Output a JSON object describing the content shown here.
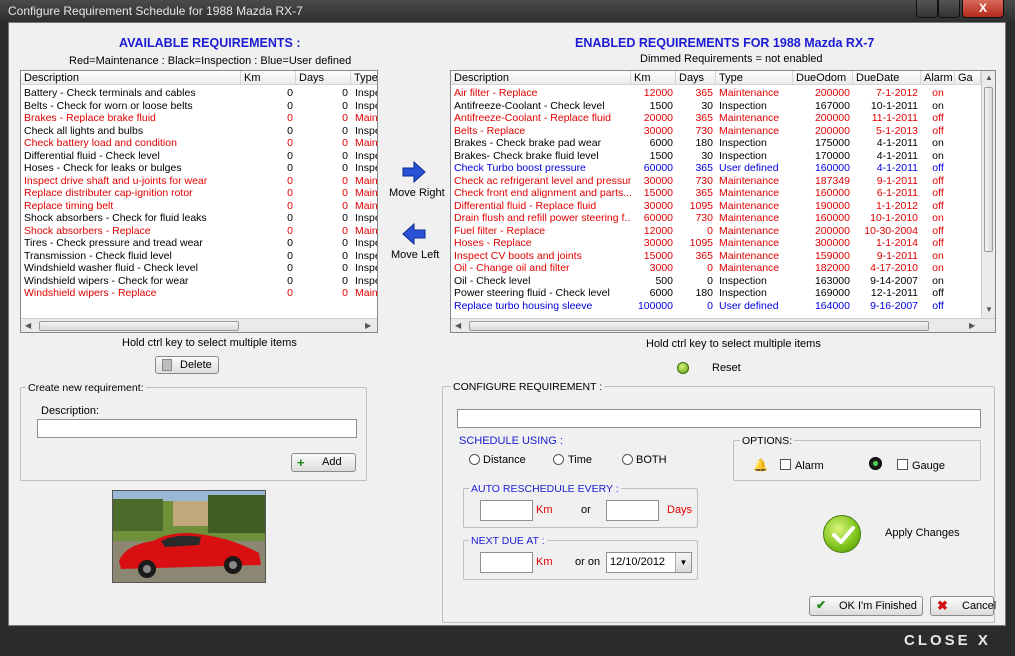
{
  "window": {
    "title": "Configure Requirement Schedule for 1988 Mazda RX-7",
    "close_symbol": "X"
  },
  "available": {
    "heading": "AVAILABLE REQUIREMENTS :",
    "legend": "Red=Maintenance  :  Black=Inspection  :  Blue=User defined",
    "columns": [
      "Description",
      "Km",
      "Days",
      "Type"
    ],
    "rows": [
      {
        "desc": "Battery - Check terminals and cables",
        "km": "0",
        "days": "0",
        "type": "Inspection",
        "color": "blk"
      },
      {
        "desc": "Belts - Check for worn or loose belts",
        "km": "0",
        "days": "0",
        "type": "Inspection",
        "color": "blk"
      },
      {
        "desc": "Brakes - Replace brake fluid",
        "km": "0",
        "days": "0",
        "type": "Maintenance",
        "color": "red"
      },
      {
        "desc": "Check all lights and bulbs",
        "km": "0",
        "days": "0",
        "type": "Inspection",
        "color": "blk"
      },
      {
        "desc": "Check battery load and condition",
        "km": "0",
        "days": "0",
        "type": "Maintenance",
        "color": "red"
      },
      {
        "desc": "Differential fluid - Check level",
        "km": "0",
        "days": "0",
        "type": "Inspection",
        "color": "blk"
      },
      {
        "desc": "Hoses - Check for leaks or bulges",
        "km": "0",
        "days": "0",
        "type": "Inspection",
        "color": "blk"
      },
      {
        "desc": "Inspect drive shaft and u-joints for wear",
        "km": "0",
        "days": "0",
        "type": "Maintenance",
        "color": "red"
      },
      {
        "desc": "Replace distributer cap-ignition rotor",
        "km": "0",
        "days": "0",
        "type": "Maintenance",
        "color": "red"
      },
      {
        "desc": "Replace timing belt",
        "km": "0",
        "days": "0",
        "type": "Maintenance",
        "color": "red"
      },
      {
        "desc": "Shock absorbers - Check for fluid leaks",
        "km": "0",
        "days": "0",
        "type": "Inspection",
        "color": "blk"
      },
      {
        "desc": "Shock absorbers - Replace",
        "km": "0",
        "days": "0",
        "type": "Maintenance",
        "color": "red"
      },
      {
        "desc": "Tires - Check pressure and tread wear",
        "km": "0",
        "days": "0",
        "type": "Inspection",
        "color": "blk"
      },
      {
        "desc": "Transmission - Check fluid level",
        "km": "0",
        "days": "0",
        "type": "Inspection",
        "color": "blk"
      },
      {
        "desc": "Windshield washer fluid - Check level",
        "km": "0",
        "days": "0",
        "type": "Inspection",
        "color": "blk"
      },
      {
        "desc": "Windshield wipers - Check for wear",
        "km": "0",
        "days": "0",
        "type": "Inspection",
        "color": "blk"
      },
      {
        "desc": "Windshield wipers - Replace",
        "km": "0",
        "days": "0",
        "type": "Maintenance",
        "color": "red"
      }
    ],
    "hint": "Hold ctrl key to select multiple items",
    "delete_label": "Delete"
  },
  "move": {
    "right_label": "Move Right",
    "left_label": "Move Left"
  },
  "enabled": {
    "heading": "ENABLED REQUIREMENTS FOR 1988 Mazda RX-7",
    "sub": "Dimmed Requirements = not enabled",
    "columns": [
      "Description",
      "Km",
      "Days",
      "Type",
      "DueOdom",
      "DueDate",
      "Alarm",
      "Ga"
    ],
    "rows": [
      {
        "desc": "Air filter - Replace",
        "km": "12000",
        "days": "365",
        "type": "Maintenance",
        "odom": "200000",
        "date": "7-1-2012",
        "alarm": "on",
        "color": "red"
      },
      {
        "desc": "Antifreeze-Coolant - Check level",
        "km": "1500",
        "days": "30",
        "type": "Inspection",
        "odom": "167000",
        "date": "10-1-2011",
        "alarm": "on",
        "color": "blk"
      },
      {
        "desc": "Antifreeze-Coolant - Replace fluid",
        "km": "20000",
        "days": "365",
        "type": "Maintenance",
        "odom": "200000",
        "date": "11-1-2011",
        "alarm": "off",
        "color": "red"
      },
      {
        "desc": "Belts - Replace",
        "km": "30000",
        "days": "730",
        "type": "Maintenance",
        "odom": "200000",
        "date": "5-1-2013",
        "alarm": "off",
        "color": "red"
      },
      {
        "desc": "Brakes - Check brake pad wear",
        "km": "6000",
        "days": "180",
        "type": "Inspection",
        "odom": "175000",
        "date": "4-1-2011",
        "alarm": "on",
        "color": "blk"
      },
      {
        "desc": "Brakes- Check brake fluid level",
        "km": "1500",
        "days": "30",
        "type": "Inspection",
        "odom": "170000",
        "date": "4-1-2011",
        "alarm": "on",
        "color": "blk"
      },
      {
        "desc": "Check Turbo boost pressure",
        "km": "60000",
        "days": "365",
        "type": "User defined",
        "odom": "160000",
        "date": "4-1-2011",
        "alarm": "off",
        "color": "blue"
      },
      {
        "desc": "Check ac refrigerant level and pressure",
        "km": "30000",
        "days": "730",
        "type": "Maintenance",
        "odom": "187349",
        "date": "9-1-2011",
        "alarm": "off",
        "color": "red"
      },
      {
        "desc": "Check front end alignment and parts...",
        "km": "15000",
        "days": "365",
        "type": "Maintenance",
        "odom": "160000",
        "date": "6-1-2011",
        "alarm": "off",
        "color": "red"
      },
      {
        "desc": "Differential fluid - Replace fluid",
        "km": "30000",
        "days": "1095",
        "type": "Maintenance",
        "odom": "190000",
        "date": "1-1-2012",
        "alarm": "off",
        "color": "red"
      },
      {
        "desc": "Drain flush and refill power steering f...",
        "km": "60000",
        "days": "730",
        "type": "Maintenance",
        "odom": "160000",
        "date": "10-1-2010",
        "alarm": "on",
        "color": "red"
      },
      {
        "desc": "Fuel filter - Replace",
        "km": "12000",
        "days": "0",
        "type": "Maintenance",
        "odom": "200000",
        "date": "10-30-2004",
        "alarm": "off",
        "color": "red"
      },
      {
        "desc": "Hoses - Replace",
        "km": "30000",
        "days": "1095",
        "type": "Maintenance",
        "odom": "300000",
        "date": "1-1-2014",
        "alarm": "off",
        "color": "red"
      },
      {
        "desc": "Inspect CV boots and joints",
        "km": "15000",
        "days": "365",
        "type": "Maintenance",
        "odom": "159000",
        "date": "9-1-2011",
        "alarm": "on",
        "color": "red"
      },
      {
        "desc": "Oil - Change oil and filter",
        "km": "3000",
        "days": "0",
        "type": "Maintenance",
        "odom": "182000",
        "date": "4-17-2010",
        "alarm": "on",
        "color": "red"
      },
      {
        "desc": "Oil - Check level",
        "km": "500",
        "days": "0",
        "type": "Inspection",
        "odom": "163000",
        "date": "9-14-2007",
        "alarm": "on",
        "color": "blk"
      },
      {
        "desc": "Power steering fluid - Check level",
        "km": "6000",
        "days": "180",
        "type": "Inspection",
        "odom": "169000",
        "date": "12-1-2011",
        "alarm": "off",
        "color": "blk"
      },
      {
        "desc": "Replace turbo housing sleeve",
        "km": "100000",
        "days": "0",
        "type": "User defined",
        "odom": "164000",
        "date": "9-16-2007",
        "alarm": "off",
        "color": "blue"
      }
    ],
    "hint": "Hold ctrl key to select multiple items",
    "reset_label": "Reset"
  },
  "create": {
    "group_label": "Create new requirement:",
    "desc_label": "Description:",
    "desc_value": "",
    "add_label": "Add"
  },
  "configure": {
    "group_label": "CONFIGURE REQUIREMENT :",
    "name_value": "",
    "schedule_label": "SCHEDULE USING :",
    "radio_distance": "Distance",
    "radio_time": "Time",
    "radio_both": "BOTH",
    "options_label": "OPTIONS:",
    "alarm_label": "Alarm",
    "gauge_label": "Gauge",
    "auto_label": "AUTO RESCHEDULE EVERY :",
    "km_unit": "Km",
    "or": "or",
    "days_unit": "Days",
    "next_label": "NEXT DUE AT :",
    "or_on": "or on",
    "date_value": "12/10/2012",
    "apply_label": "Apply Changes",
    "finish_label": "OK I'm Finished",
    "cancel_label": "Cancel"
  },
  "footer": {
    "close_label": "CLOSE X"
  },
  "colors": {
    "maintenance": "#e00000",
    "inspection": "#000000",
    "user_defined": "#0000e0",
    "heading_blue": "#1b1bd6"
  }
}
